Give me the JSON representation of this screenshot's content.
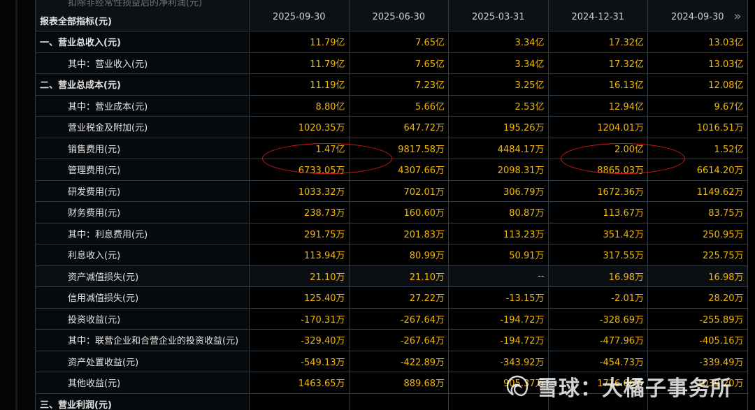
{
  "header": {
    "first_col_label": "报表全部指标(元)",
    "cut_off_label": "扣除非经常性损益后的净利润(元)",
    "periods": [
      "2025-09-30",
      "2025-06-30",
      "2025-03-31",
      "2024-12-31",
      "2024-09-30"
    ],
    "next_icon": "chevron-double-right-icon"
  },
  "rows": [
    {
      "label": "一、营业总收入(元)",
      "level": "top",
      "values": [
        "11.79亿",
        "7.65亿",
        "3.34亿",
        "17.32亿",
        "13.03亿"
      ]
    },
    {
      "label": "其中：营业收入(元)",
      "level": "sub",
      "values": [
        "11.79亿",
        "7.65亿",
        "3.34亿",
        "17.32亿",
        "13.03亿"
      ]
    },
    {
      "label": "二、营业总成本(元)",
      "level": "top",
      "values": [
        "11.19亿",
        "7.23亿",
        "3.25亿",
        "16.13亿",
        "12.08亿"
      ]
    },
    {
      "label": "其中：营业成本(元)",
      "level": "sub",
      "values": [
        "8.80亿",
        "5.66亿",
        "2.53亿",
        "12.94亿",
        "9.67亿"
      ]
    },
    {
      "label": "营业税金及附加(元)",
      "level": "sub",
      "values": [
        "1020.35万",
        "647.72万",
        "195.26万",
        "1204.01万",
        "1016.51万"
      ]
    },
    {
      "label": "销售费用(元)",
      "level": "sub",
      "values": [
        "1.47亿",
        "9817.58万",
        "4484.17万",
        "2.00亿",
        "1.52亿"
      ]
    },
    {
      "label": "管理费用(元)",
      "level": "sub",
      "values": [
        "6733.05万",
        "4307.66万",
        "2098.31万",
        "8865.03万",
        "6614.20万"
      ]
    },
    {
      "label": "研发费用(元)",
      "level": "sub",
      "values": [
        "1033.32万",
        "702.01万",
        "306.79万",
        "1672.36万",
        "1149.62万"
      ]
    },
    {
      "label": "财务费用(元)",
      "level": "sub",
      "values": [
        "238.73万",
        "160.60万",
        "80.87万",
        "113.67万",
        "83.75万"
      ]
    },
    {
      "label": "其中：利息费用(元)",
      "level": "sub",
      "values": [
        "291.75万",
        "201.83万",
        "113.23万",
        "351.42万",
        "250.95万"
      ]
    },
    {
      "label": "利息收入(元)",
      "level": "sub",
      "values": [
        "113.94万",
        "80.99万",
        "50.91万",
        "317.55万",
        "225.75万"
      ]
    },
    {
      "label": "资产减值损失(元)",
      "level": "sub",
      "values": [
        "21.10万",
        "21.10万",
        "--",
        "16.98万",
        "16.98万"
      ]
    },
    {
      "label": "信用减值损失(元)",
      "level": "sub",
      "values": [
        "125.40万",
        "27.22万",
        "-13.15万",
        "-2.01万",
        "28.20万"
      ]
    },
    {
      "label": "投资收益(元)",
      "level": "sub",
      "values": [
        "-170.31万",
        "-267.64万",
        "-194.72万",
        "-328.69万",
        "-255.89万"
      ]
    },
    {
      "label": "其中：联营企业和合营企业的投资收益(元)",
      "level": "sub",
      "values": [
        "-329.40万",
        "-267.64万",
        "-194.72万",
        "-477.96万",
        "-405.16万"
      ]
    },
    {
      "label": "资产处置收益(元)",
      "level": "sub",
      "values": [
        "-549.13万",
        "-422.89万",
        "-343.92万",
        "-454.73万",
        "-339.49万"
      ]
    },
    {
      "label": "其他收益(元)",
      "level": "sub",
      "values": [
        "1463.65万",
        "889.68万",
        "905.37万",
        "1716.06万",
        "1039.20万"
      ]
    },
    {
      "label": "三、营业利润(元)",
      "level": "top",
      "values": [
        "",
        "",
        "",
        "",
        ""
      ]
    }
  ],
  "highlight_color": "#d11a1a",
  "value_color": "#f2b705",
  "watermark": {
    "text": "雪球：大橘子事务所",
    "icon": "xueqiu-logo-icon"
  }
}
